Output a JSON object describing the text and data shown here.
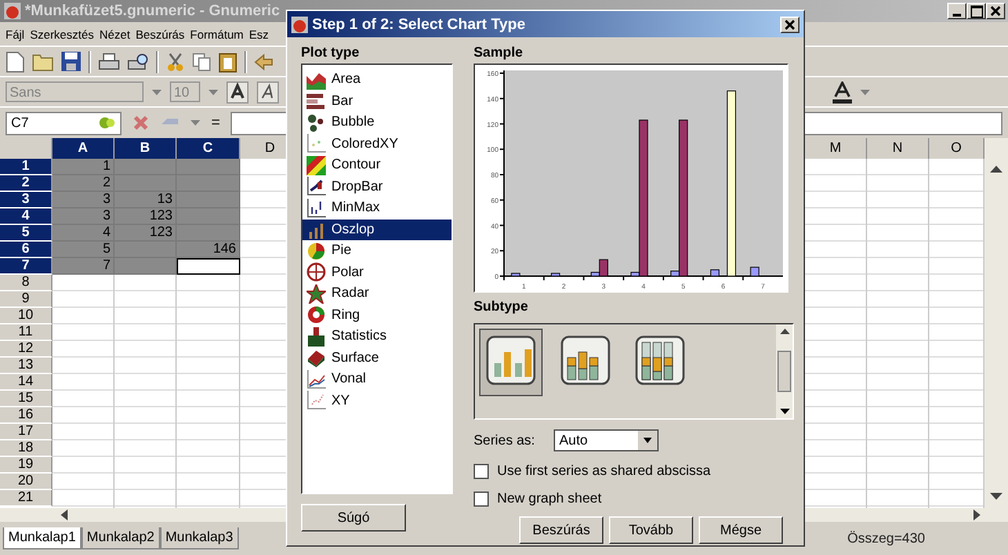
{
  "window": {
    "title": "*Munkafüzet5.gnumeric - Gnumeric"
  },
  "menu": [
    "Fájl",
    "Szerkesztés",
    "Nézet",
    "Beszúrás",
    "Formátum",
    "Esz"
  ],
  "format_toolbar": {
    "font": "Sans",
    "size": "10"
  },
  "formula_bar": {
    "cell_ref": "C7",
    "equals": "="
  },
  "sheet": {
    "columns": [
      {
        "label": "A",
        "selected": true
      },
      {
        "label": "B",
        "selected": true
      },
      {
        "label": "C",
        "selected": true
      },
      {
        "label": "D",
        "selected": false
      }
    ],
    "right_columns": [
      {
        "label": "M",
        "selected": false
      },
      {
        "label": "N",
        "selected": false
      },
      {
        "label": "O",
        "selected": false
      }
    ],
    "rows": [
      {
        "number": "1",
        "selected": true,
        "cells": [
          {
            "value": "1"
          },
          null,
          null,
          null
        ]
      },
      {
        "number": "2",
        "selected": true,
        "cells": [
          {
            "value": "2"
          },
          null,
          null,
          null
        ]
      },
      {
        "number": "3",
        "selected": true,
        "cells": [
          {
            "value": "3"
          },
          {
            "value": "13"
          },
          null,
          null
        ]
      },
      {
        "number": "4",
        "selected": true,
        "cells": [
          {
            "value": "3"
          },
          {
            "value": "123"
          },
          null,
          null
        ]
      },
      {
        "number": "5",
        "selected": true,
        "cells": [
          {
            "value": "4"
          },
          {
            "value": "123"
          },
          null,
          null
        ]
      },
      {
        "number": "6",
        "selected": true,
        "cells": [
          {
            "value": "5"
          },
          null,
          {
            "value": "146"
          },
          null
        ]
      },
      {
        "number": "7",
        "selected": true,
        "cells": [
          {
            "value": "7"
          },
          null,
          {
            "active": true
          },
          null
        ]
      },
      {
        "number": "8",
        "selected": false
      },
      {
        "number": "9",
        "selected": false
      },
      {
        "number": "10",
        "selected": false
      },
      {
        "number": "11",
        "selected": false
      },
      {
        "number": "12",
        "selected": false
      },
      {
        "number": "13",
        "selected": false
      },
      {
        "number": "14",
        "selected": false
      },
      {
        "number": "15",
        "selected": false
      },
      {
        "number": "16",
        "selected": false
      },
      {
        "number": "17",
        "selected": false
      },
      {
        "number": "18",
        "selected": false
      },
      {
        "number": "19",
        "selected": false
      },
      {
        "number": "20",
        "selected": false
      },
      {
        "number": "21",
        "selected": false
      }
    ]
  },
  "sheet_tabs": [
    {
      "label": "Munkalap1",
      "selected": true
    },
    {
      "label": "Munkalap2",
      "selected": false
    },
    {
      "label": "Munkalap3",
      "selected": false
    }
  ],
  "status": "Összeg=430",
  "dialog": {
    "title": "Step 1 of 2: Select Chart Type",
    "plot_type_label": "Plot type",
    "plot_types": [
      {
        "label": "Area",
        "selected": false
      },
      {
        "label": "Bar",
        "selected": false
      },
      {
        "label": "Bubble",
        "selected": false
      },
      {
        "label": "ColoredXY",
        "selected": false
      },
      {
        "label": "Contour",
        "selected": false
      },
      {
        "label": "DropBar",
        "selected": false
      },
      {
        "label": "MinMax",
        "selected": false
      },
      {
        "label": "Oszlop",
        "selected": true
      },
      {
        "label": "Pie",
        "selected": false
      },
      {
        "label": "Polar",
        "selected": false
      },
      {
        "label": "Radar",
        "selected": false
      },
      {
        "label": "Ring",
        "selected": false
      },
      {
        "label": "Statistics",
        "selected": false
      },
      {
        "label": "Surface",
        "selected": false
      },
      {
        "label": "Vonal",
        "selected": false
      },
      {
        "label": "XY",
        "selected": false
      }
    ],
    "sample_label": "Sample",
    "chart_data": {
      "type": "bar",
      "categories": [
        "1",
        "2",
        "3",
        "4",
        "5",
        "6",
        "7"
      ],
      "ylim": [
        0,
        160
      ],
      "yticks": [
        0,
        20,
        40,
        60,
        80,
        100,
        120,
        140,
        160
      ],
      "series": [
        {
          "color": "#9999ff",
          "values": [
            1,
            2,
            3,
            3,
            4,
            5,
            7
          ]
        },
        {
          "color": "#993366",
          "values": [
            null,
            null,
            13,
            123,
            123,
            null,
            null
          ]
        },
        {
          "color": "#ffffcc",
          "values": [
            null,
            null,
            null,
            null,
            null,
            146,
            null
          ]
        }
      ]
    },
    "subtype_label": "Subtype",
    "subtypes": [
      {
        "kind": "clustered",
        "selected": true
      },
      {
        "kind": "stacked",
        "selected": false
      },
      {
        "kind": "percent",
        "selected": false
      }
    ],
    "series_as": {
      "label": "Series as:",
      "value": "Auto"
    },
    "options": [
      {
        "label": "Use first series as shared abscissa",
        "checked": false
      },
      {
        "label": "New graph sheet",
        "checked": false
      }
    ],
    "help_button": "Súgó",
    "buttons": [
      "Beszúrás",
      "Tovább",
      "Mégse"
    ]
  }
}
